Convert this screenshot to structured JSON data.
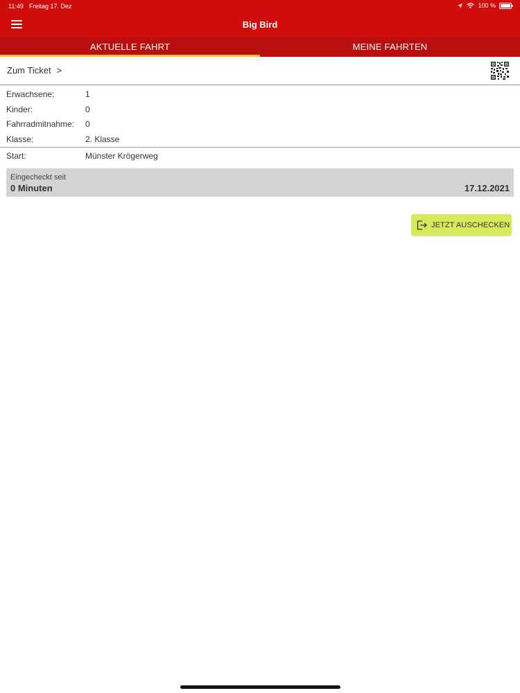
{
  "status_bar": {
    "time": "11:49",
    "date": "Freitag 17. Dez",
    "battery_text": "100 %",
    "icons": [
      "location-arrow-icon",
      "wifi-icon",
      "battery-icon"
    ]
  },
  "nav": {
    "title": "Big Bird",
    "menu_icon": "hamburger-menu-icon"
  },
  "tabs": [
    {
      "label": "AKTUELLE FAHRT",
      "active": true
    },
    {
      "label": "MEINE FAHRTEN",
      "active": false
    }
  ],
  "ticket": {
    "link_label": "Zum Ticket",
    "chevron": ">",
    "qr_icon": "qr-code-icon"
  },
  "details": [
    {
      "label": "Erwachsene:",
      "value": "1"
    },
    {
      "label": "Kinder:",
      "value": "0"
    },
    {
      "label": "Fahrradmitnahme:",
      "value": "0"
    },
    {
      "label": "Klasse:",
      "value": "2. Klasse"
    }
  ],
  "start": {
    "label": "Start:",
    "value": "Münster Krögerweg"
  },
  "checkin": {
    "label": "Eingecheckt seit",
    "duration": "0 Minuten",
    "date": "17.12.2021"
  },
  "checkout": {
    "label": "JETZT AUSCHECKEN",
    "icon": "logout-icon"
  },
  "colors": {
    "header": "#cf0d0d",
    "tabbar": "#b90f0f",
    "tab_indicator": "#f5c542",
    "checkout_button": "#d6ea5c",
    "panel": "#d4d4d6"
  }
}
